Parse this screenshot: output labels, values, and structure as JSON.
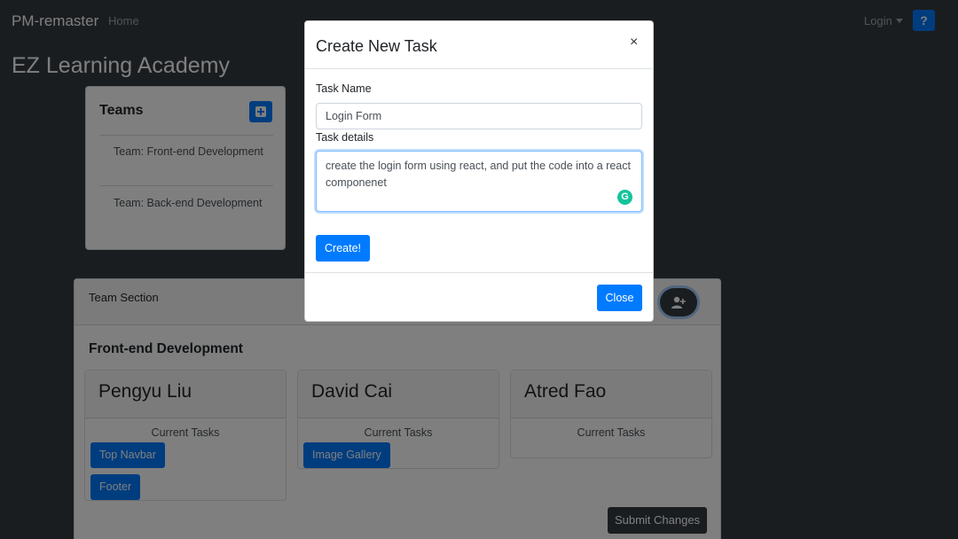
{
  "navbar": {
    "brand": "PM-remaster",
    "home_link": "Home",
    "login_link": "Login",
    "help_button": "?"
  },
  "page": {
    "title": "EZ Learning Academy"
  },
  "teams": {
    "title": "Teams",
    "add_icon": "plus-square-icon",
    "items": [
      {
        "label": "Team: Front-end Development"
      },
      {
        "label": "Team: Back-end Development"
      }
    ]
  },
  "team_section": {
    "header_label": "Team Section",
    "add_member_icon": "user-plus-icon",
    "team_name": "Front-end Development",
    "members": [
      {
        "name": "Pengyu Liu",
        "tasks_label": "Current Tasks",
        "tasks": [
          "Top Navbar",
          "Footer"
        ]
      },
      {
        "name": "David Cai",
        "tasks_label": "Current Tasks",
        "tasks": [
          "Image Gallery"
        ]
      },
      {
        "name": "Atred Fao",
        "tasks_label": "Current Tasks",
        "tasks": []
      }
    ],
    "submit_label": "Submit Changes"
  },
  "modal": {
    "title": "Create New Task",
    "close_symbol": "×",
    "task_name_label": "Task Name",
    "task_name_value": "Login Form",
    "task_details_label": "Task details",
    "task_details_value": "create the login form using react, and put the code into a react componenet",
    "grammarly_icon": "grammarly-icon",
    "create_label": "Create!",
    "close_label": "Close"
  },
  "colors": {
    "primary": "#007bff",
    "dark": "#343a40",
    "grammarly": "#15c39a"
  }
}
